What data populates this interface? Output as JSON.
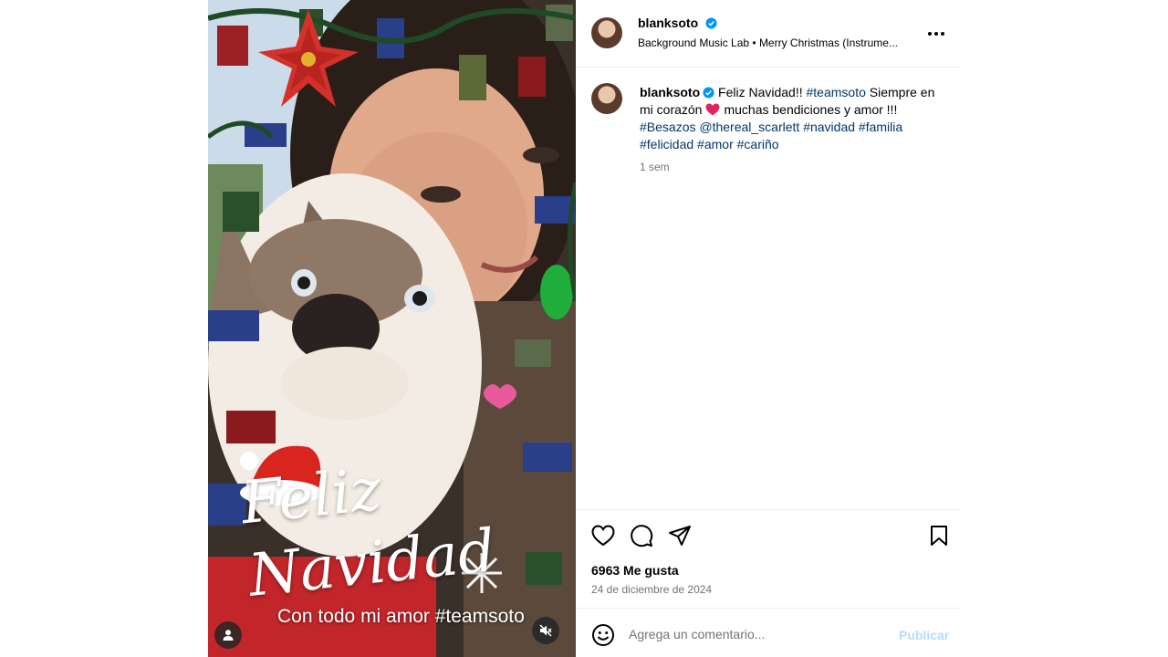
{
  "post": {
    "username": "blanksoto",
    "audio": "Background Music Lab • Merry Christmas (Instrume...",
    "caption": {
      "username": "blanksoto",
      "intro": "Feliz Navidad!!",
      "tag_teamsoto": "#teamsoto",
      "part1": "Siempre en mi corazón",
      "part2": "muchas bendiciones y amor !!!",
      "tags": [
        "#Besazos",
        "@thereal_scarlett",
        "#navidad",
        "#familia",
        "#felicidad",
        "#amor",
        "#cariño"
      ],
      "time": "1 sem"
    },
    "likes": "6963 Me gusta",
    "date": "24 de diciembre de 2024"
  },
  "media": {
    "overlay_title_line1": "Feliz",
    "overlay_title_line2": "Navidad",
    "overlay_sub": "Con todo mi amor #teamsoto"
  },
  "comment": {
    "placeholder": "Agrega un comentario...",
    "publish_label": "Publicar"
  },
  "colors": {
    "verified": "#0095f6",
    "link": "#00376b",
    "muted_text": "#737373",
    "publish_disabled": "#b3dbff",
    "heart": "#e0245e"
  },
  "icons": [
    "verified-badge-icon",
    "more-options-icon",
    "heart-icon",
    "comment-icon",
    "share-icon",
    "bookmark-icon",
    "emoji-icon",
    "user-tag-icon",
    "mute-icon"
  ]
}
